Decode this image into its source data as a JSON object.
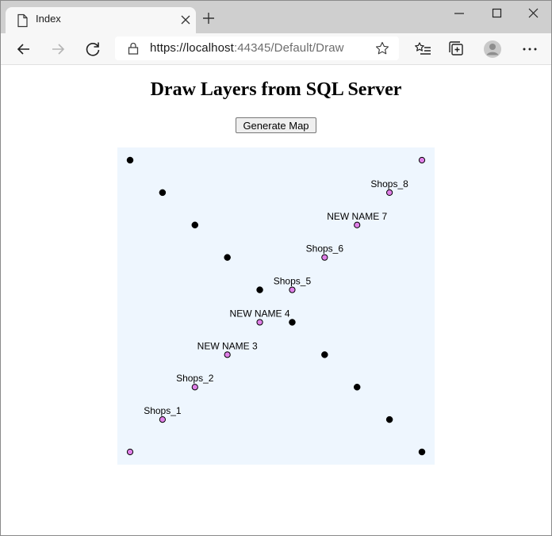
{
  "browser": {
    "tab": {
      "title": "Index"
    },
    "address": {
      "url_host": "https://localhost",
      "url_rest": ":44345/Default/Draw"
    }
  },
  "page": {
    "heading": "Draw Layers from SQL Server",
    "generate_button": "Generate Map"
  },
  "colors": {
    "map_background": "#eef6fe",
    "layer1_fill": "#000000",
    "layer2_fill": "#e080e8"
  },
  "map": {
    "layers": [
      {
        "name": "",
        "color": "black",
        "points": [
          {
            "x": 0,
            "y": 0
          },
          {
            "x": 1,
            "y": 1
          },
          {
            "x": 2,
            "y": 2
          },
          {
            "x": 3,
            "y": 3
          },
          {
            "x": 4,
            "y": 4
          },
          {
            "x": 5,
            "y": 5
          },
          {
            "x": 6,
            "y": 6
          },
          {
            "x": 7,
            "y": 7
          },
          {
            "x": 8,
            "y": 8
          },
          {
            "x": 9,
            "y": 9
          }
        ]
      },
      {
        "name": "",
        "color": "violet",
        "points": [
          {
            "x": 0,
            "y": 9,
            "label": ""
          },
          {
            "x": 1,
            "y": 8,
            "label": "Shops_1"
          },
          {
            "x": 2,
            "y": 7,
            "label": "Shops_2"
          },
          {
            "x": 3,
            "y": 6,
            "label": "NEW NAME 3"
          },
          {
            "x": 4,
            "y": 5,
            "label": "NEW NAME 4"
          },
          {
            "x": 5,
            "y": 4,
            "label": "Shops_5"
          },
          {
            "x": 6,
            "y": 3,
            "label": "Shops_6"
          },
          {
            "x": 7,
            "y": 2,
            "label": "NEW NAME 7"
          },
          {
            "x": 8,
            "y": 1,
            "label": "Shops_8"
          },
          {
            "x": 9,
            "y": 0,
            "label": ""
          }
        ]
      }
    ]
  }
}
